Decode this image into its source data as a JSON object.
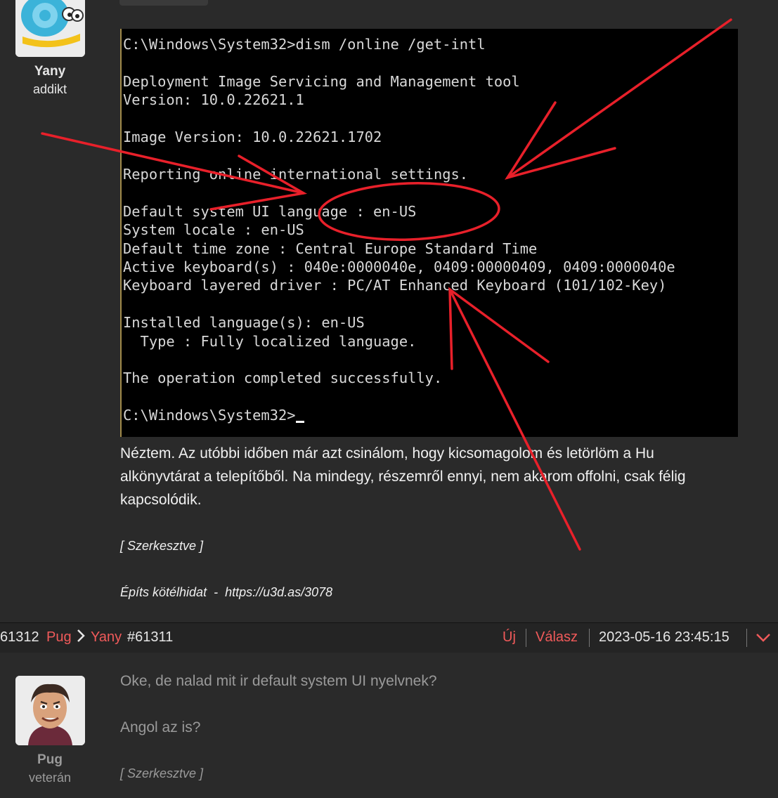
{
  "post1": {
    "user": {
      "name": "Yany",
      "rank": "addikt",
      "avatar_icon": "snail-avatar-icon"
    },
    "terminal": {
      "lines": [
        "C:\\Windows\\System32>dism /online /get-intl",
        "Deployment Image Servicing and Management tool",
        "Version: 10.0.22621.1",
        "Image Version: 10.0.22621.1702",
        "Reporting online international settings.",
        "Default system UI language : en-US",
        "System locale : en-US",
        "Default time zone : Central Europe Standard Time",
        "Active keyboard(s) : 040e:0000040e, 0409:00000409, 0409:0000040e",
        "Keyboard layered driver : PC/AT Enhanced Keyboard (101/102-Key)",
        "Installed language(s): en-US",
        "  Type : Fully localized language.",
        "The operation completed successfully.",
        "C:\\Windows\\System32>"
      ]
    },
    "text_lines": [
      "Néztem. Az utóbbi időben már azt csinálom, hogy kicsomagolom és letörlöm a Hu",
      "alkönyvtárat a telepítőből. Na mindegy, részemről ennyi, nem akarom offolni, csak félig",
      "kapcsolódik."
    ],
    "edited": "[ Szerkesztve ]",
    "signature": "Építs kötélhidat  -  https://u3d.as/3078"
  },
  "meta_bar": {
    "post_id": "61312",
    "author": "Pug",
    "reply_to_user": "Yany",
    "reply_to_id": "#61311",
    "new_label": "Új",
    "reply_label": "Válasz",
    "timestamp": "2023-05-16 23:45:15",
    "accent_color": "#f05a5a"
  },
  "post2": {
    "user": {
      "name": "Pug",
      "rank": "veterán",
      "avatar_icon": "man-portrait-avatar-icon"
    },
    "text_lines": [
      "Oke, de nalad mit ir default system UI nyelvnek?",
      "Angol az is?"
    ],
    "edited": "[ Szerkesztve ]"
  }
}
